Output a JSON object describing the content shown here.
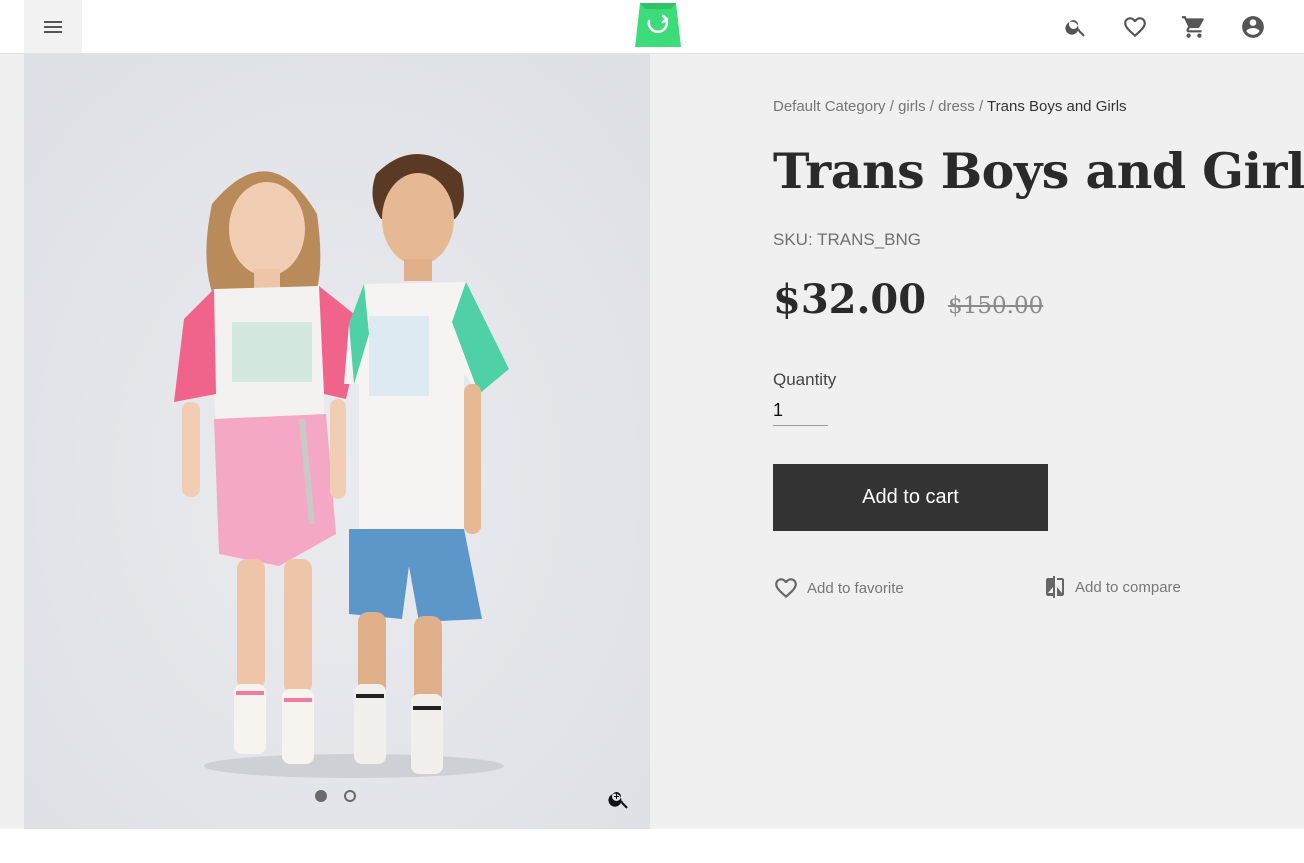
{
  "header": {
    "menu_icon": "hamburger-menu-icon",
    "logo_icon": "shopping-bag-logo",
    "logo_color": "#3ddc7a",
    "icons": [
      "search-icon",
      "heart-icon",
      "cart-icon",
      "account-icon"
    ]
  },
  "breadcrumb": {
    "items": [
      "Default Category",
      "girls",
      "dress"
    ],
    "separator": " / ",
    "current": "Trans Boys and Girls"
  },
  "product": {
    "title": "Trans Boys and Girls",
    "sku": "SKU: TRANS_BNG",
    "price": "$32.00",
    "old_price": "$150.00"
  },
  "quantity": {
    "label": "Quantity",
    "value": "1"
  },
  "actions": {
    "add_to_cart": "Add to cart",
    "add_to_favorite": "Add to favorite",
    "add_to_compare": "Add to compare"
  },
  "gallery": {
    "image_count": 2,
    "active_index": 0,
    "zoom_icon": "zoom-in-icon"
  },
  "colors": {
    "button_bg": "#333333",
    "page_bg": "#f0f0f0",
    "accent": "#3ddc7a"
  }
}
